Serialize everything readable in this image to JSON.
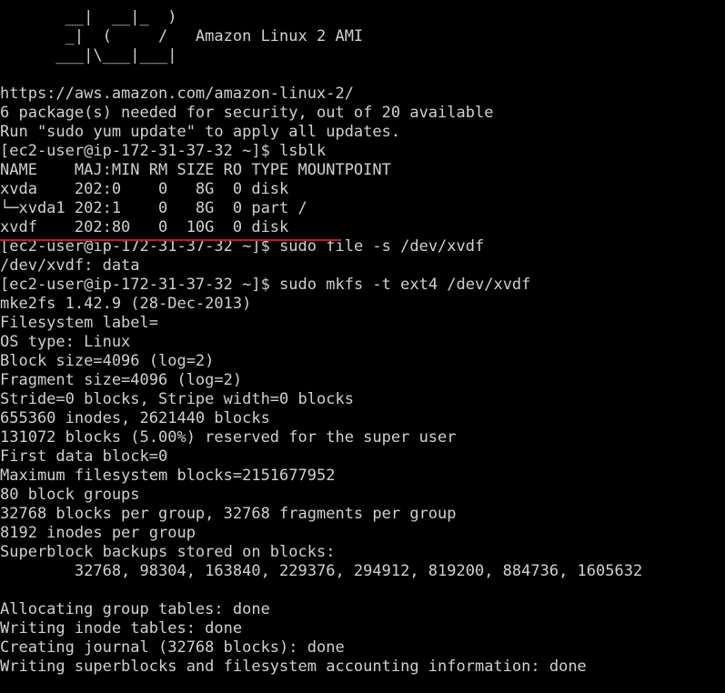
{
  "theme": {
    "background": "#000000",
    "foreground": "#d0d0d0",
    "annotation_underline_color": "#d01818"
  },
  "terminal": {
    "banner": [
      "       __|  __|_  )",
      "       _|  (     /   Amazon Linux 2 AMI",
      "      ___|\\___|___|"
    ],
    "motd": [
      "https://aws.amazon.com/amazon-linux-2/",
      "6 package(s) needed for security, out of 20 available",
      "Run \"sudo yum update\" to apply all updates."
    ],
    "prompt": "[ec2-user@ip-172-31-37-32 ~]$",
    "commands": [
      {
        "command": "lsblk",
        "output": [
          "NAME    MAJ:MIN RM SIZE RO TYPE MOUNTPOINT",
          "xvda    202:0    0   8G  0 disk",
          "└─xvda1 202:1    0   8G  0 part /",
          "xvdf    202:80   0  10G  0 disk"
        ]
      },
      {
        "command": "sudo file -s /dev/xvdf",
        "output": [
          "/dev/xvdf: data"
        ]
      },
      {
        "command": "sudo mkfs -t ext4 /dev/xvdf",
        "output": [
          "mke2fs 1.42.9 (28-Dec-2013)",
          "Filesystem label=",
          "OS type: Linux",
          "Block size=4096 (log=2)",
          "Fragment size=4096 (log=2)",
          "Stride=0 blocks, Stripe width=0 blocks",
          "655360 inodes, 2621440 blocks",
          "131072 blocks (5.00%) reserved for the super user",
          "First data block=0",
          "Maximum filesystem blocks=2151677952",
          "80 block groups",
          "32768 blocks per group, 32768 fragments per group",
          "8192 inodes per group",
          "Superblock backups stored on blocks:",
          "        32768, 98304, 163840, 229376, 294912, 819200, 884736, 1605632",
          "",
          "Allocating group tables: done",
          "Writing inode tables: done",
          "Creating journal (32768 blocks): done",
          "Writing superblocks and filesystem accounting information: done"
        ]
      }
    ]
  }
}
